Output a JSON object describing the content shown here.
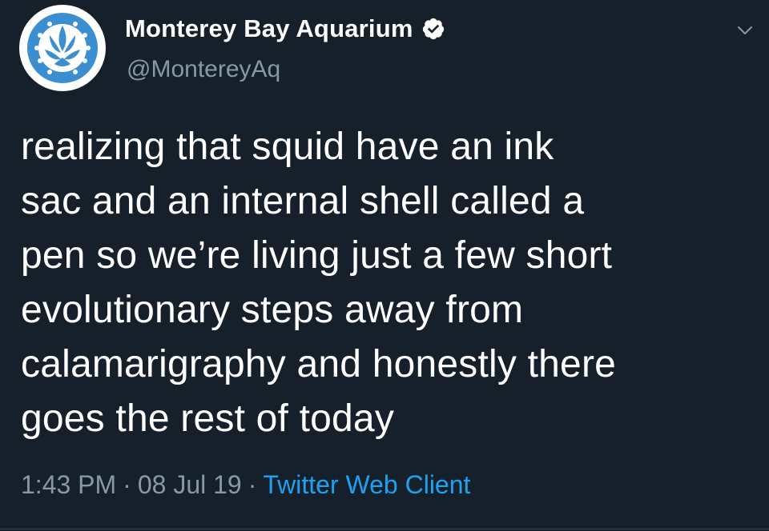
{
  "author": {
    "display_name": "Monterey Bay Aquarium",
    "handle": "@MontereyAq",
    "verified": true,
    "avatar_icon": "monterey-bay-aquarium-logo",
    "badge_icon": "verified-badge-icon"
  },
  "tweet": {
    "text": "realizing that squid have an ink\nsac and an internal shell called a\npen so we’re living just a few short\nevolutionary steps away from\ncalamarigraphy and honestly there\ngoes the rest of today"
  },
  "meta": {
    "time": "1:43 PM",
    "separator": "·",
    "date": "08 Jul 19",
    "client": "Twitter Web Client"
  },
  "menu": {
    "icon": "chevron-down-icon"
  },
  "colors": {
    "background": "#15202b",
    "primary_text": "#ffffff",
    "secondary_text": "#8899a6",
    "accent": "#1da1f2",
    "logo_blue": "#3b8fd0"
  }
}
